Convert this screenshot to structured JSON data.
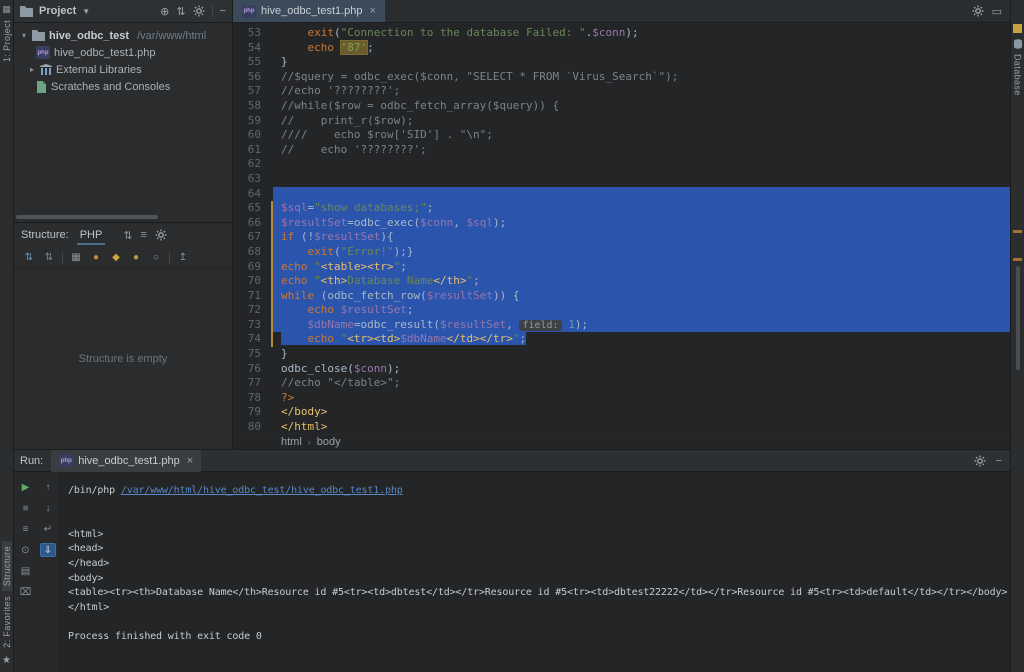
{
  "stripes": {
    "project_button": "1: Project",
    "structure_button": "Structure",
    "favorites_button": "2: Favorites",
    "database_button": "Database"
  },
  "project_panel": {
    "toolbar_title": "Project",
    "tree": {
      "root_name": "hive_odbc_test",
      "root_path": "/var/www/html",
      "file_name": "hive_odbc_test1.php",
      "external_libraries": "External Libraries",
      "scratches": "Scratches and Consoles"
    }
  },
  "structure_panel": {
    "title": "Structure:",
    "tab_label": "PHP",
    "empty_message": "Structure is empty"
  },
  "editor": {
    "tab_label": "hive_odbc_test1.php",
    "breadcrumbs": [
      "html",
      "body"
    ],
    "first_line": 53,
    "lines": [
      {
        "n": 53,
        "segs": [
          [
            "d",
            "    "
          ],
          [
            "kw",
            "exit"
          ],
          [
            "d",
            "("
          ],
          [
            "str",
            "\"Connection to the database Failed: \""
          ],
          [
            "d",
            "."
          ],
          [
            "var",
            "$conn"
          ],
          [
            "d",
            ");"
          ]
        ]
      },
      {
        "n": 54,
        "segs": [
          [
            "d",
            "    "
          ],
          [
            "kw",
            "echo"
          ],
          [
            "d",
            " "
          ],
          [
            "strhl",
            "'87'"
          ],
          [
            "d",
            ";"
          ]
        ]
      },
      {
        "n": 55,
        "segs": [
          [
            "d",
            "}"
          ]
        ]
      },
      {
        "n": 56,
        "segs": [
          [
            "cmt",
            "//$query = odbc_exec($conn, \"SELECT * FROM `Virus_Search`\");"
          ]
        ]
      },
      {
        "n": 57,
        "segs": [
          [
            "cmt",
            "//echo '????????';"
          ]
        ]
      },
      {
        "n": 58,
        "segs": [
          [
            "cmt",
            "//while($row = odbc_fetch_array($query)) {"
          ]
        ]
      },
      {
        "n": 59,
        "segs": [
          [
            "cmt",
            "//    print_r($row);"
          ]
        ]
      },
      {
        "n": 60,
        "segs": [
          [
            "cmt",
            "////    echo $row['SID'] . \"\\n\";"
          ]
        ]
      },
      {
        "n": 61,
        "segs": [
          [
            "cmt",
            "//    echo '????????';"
          ]
        ]
      },
      {
        "n": 62,
        "segs": []
      },
      {
        "n": 63,
        "segs": []
      },
      {
        "n": 64,
        "sel": "full",
        "segs": []
      },
      {
        "n": 65,
        "sel": "full",
        "segs": [
          [
            "var",
            "$sql"
          ],
          [
            "d",
            "="
          ],
          [
            "str",
            "\"show databases;\""
          ],
          [
            "d",
            ";"
          ]
        ]
      },
      {
        "n": 66,
        "sel": "full",
        "segs": [
          [
            "var",
            "$resultSet"
          ],
          [
            "d",
            "=odbc_exec("
          ],
          [
            "var",
            "$conn"
          ],
          [
            "d",
            ", "
          ],
          [
            "var",
            "$sql"
          ],
          [
            "d",
            ");"
          ]
        ]
      },
      {
        "n": 67,
        "sel": "full",
        "segs": [
          [
            "kw",
            "if"
          ],
          [
            "d",
            " (!"
          ],
          [
            "var",
            "$resultSet"
          ],
          [
            "d",
            "){"
          ]
        ]
      },
      {
        "n": 68,
        "sel": "full",
        "segs": [
          [
            "d",
            "    "
          ],
          [
            "kw",
            "exit"
          ],
          [
            "d",
            "("
          ],
          [
            "str",
            "\"Error!\""
          ],
          [
            "d",
            ");}"
          ]
        ]
      },
      {
        "n": 69,
        "sel": "full",
        "segs": [
          [
            "kw",
            "echo"
          ],
          [
            "d",
            " "
          ],
          [
            "str",
            "\""
          ],
          [
            "tag",
            "<table><tr>"
          ],
          [
            "str",
            "\""
          ],
          [
            "d",
            ";"
          ]
        ]
      },
      {
        "n": 70,
        "sel": "full",
        "segs": [
          [
            "kw",
            "echo"
          ],
          [
            "d",
            " "
          ],
          [
            "str",
            "\""
          ],
          [
            "tag",
            "<th>"
          ],
          [
            "str",
            "Database Name"
          ],
          [
            "tag",
            "</th>"
          ],
          [
            "str",
            "\""
          ],
          [
            "d",
            ";"
          ]
        ]
      },
      {
        "n": 71,
        "sel": "full",
        "segs": [
          [
            "kw",
            "while"
          ],
          [
            "d",
            " (odbc_fetch_row("
          ],
          [
            "var",
            "$resultSet"
          ],
          [
            "d",
            ")) {"
          ]
        ]
      },
      {
        "n": 72,
        "sel": "full",
        "segs": [
          [
            "d",
            "    "
          ],
          [
            "kw",
            "echo"
          ],
          [
            "d",
            " "
          ],
          [
            "var",
            "$resultSet"
          ],
          [
            "d",
            ";"
          ]
        ]
      },
      {
        "n": 73,
        "sel": "full",
        "segs": [
          [
            "d",
            "    "
          ],
          [
            "var",
            "$dbName"
          ],
          [
            "d",
            "=odbc_result("
          ],
          [
            "var",
            "$resultSet"
          ],
          [
            "d",
            ", "
          ],
          [
            "hint",
            "field:"
          ],
          [
            "d",
            " "
          ],
          [
            "num",
            "1"
          ],
          [
            "d",
            ");"
          ]
        ]
      },
      {
        "n": 74,
        "sel": "text",
        "segs": [
          [
            "d",
            "    "
          ],
          [
            "kw",
            "echo"
          ],
          [
            "d",
            " "
          ],
          [
            "str",
            "\""
          ],
          [
            "tag",
            "<tr><td>"
          ],
          [
            "var",
            "$dbName"
          ],
          [
            "tag",
            "</td></tr>"
          ],
          [
            "str",
            "\""
          ],
          [
            "d",
            ";"
          ]
        ]
      },
      {
        "n": 75,
        "segs": [
          [
            "d",
            "}"
          ]
        ]
      },
      {
        "n": 76,
        "segs": [
          [
            "d",
            "odbc_close("
          ],
          [
            "var",
            "$conn"
          ],
          [
            "d",
            ");"
          ]
        ]
      },
      {
        "n": 77,
        "segs": [
          [
            "cmt",
            "//echo \"</table>\";"
          ]
        ]
      },
      {
        "n": 78,
        "segs": [
          [
            "kw",
            "?>"
          ]
        ]
      },
      {
        "n": 79,
        "segs": [
          [
            "tag",
            "</body>"
          ]
        ]
      },
      {
        "n": 80,
        "segs": [
          [
            "tag",
            "</html>"
          ]
        ]
      }
    ]
  },
  "run_panel": {
    "title": "Run:",
    "tab_label": "hive_odbc_test1.php",
    "output": [
      {
        "segs": [
          [
            "out",
            "/bin/php "
          ],
          [
            "link",
            "/var/www/html/hive_odbc_test/hive_odbc_test1.php"
          ]
        ]
      },
      {
        "segs": []
      },
      {
        "segs": []
      },
      {
        "segs": [
          [
            "out",
            "<html>"
          ]
        ]
      },
      {
        "segs": [
          [
            "out",
            "<head>"
          ]
        ]
      },
      {
        "segs": [
          [
            "out",
            "</head>"
          ]
        ]
      },
      {
        "segs": [
          [
            "out",
            "<body>"
          ]
        ]
      },
      {
        "segs": [
          [
            "out",
            "<table><tr><th>Database Name</th>Resource id #5<tr><td>dbtest</td></tr>Resource id #5<tr><td>dbtest22222</td></tr>Resource id #5<tr><td>default</td></tr></body>"
          ]
        ]
      },
      {
        "segs": [
          [
            "out",
            "</html>"
          ]
        ]
      },
      {
        "segs": []
      },
      {
        "segs": [
          [
            "out",
            "Process finished with exit code 0"
          ]
        ]
      }
    ]
  },
  "colors": {
    "selection": "#2b55ad",
    "keyword": "#cc7832",
    "string": "#6a8759",
    "variable": "#9876aa",
    "link": "#5888c6",
    "inspection_indicator": "#c9a23c"
  }
}
